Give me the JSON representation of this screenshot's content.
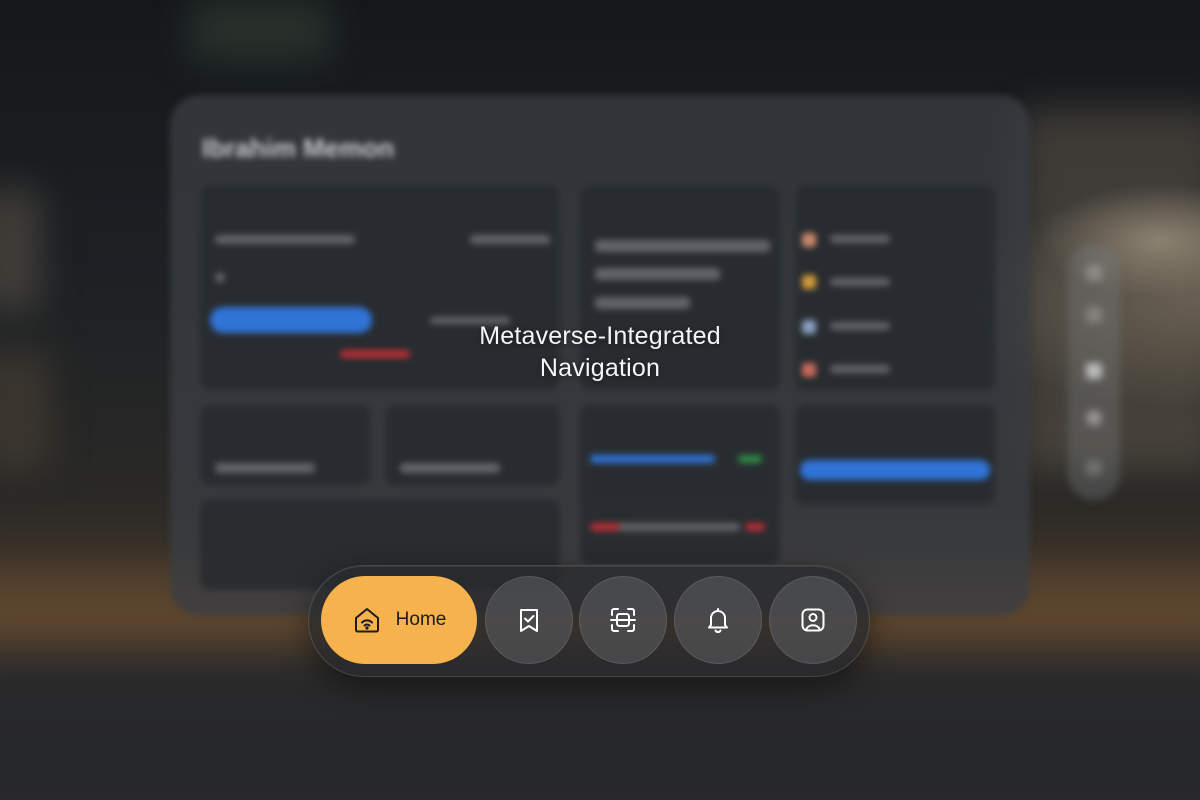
{
  "headline": {
    "line1": "Metaverse-Integrated",
    "line2": "Navigation"
  },
  "background_window": {
    "title": "Ibrahim Memon"
  },
  "dock": {
    "items": [
      {
        "label": "Home",
        "icon": "home-wifi-icon",
        "active": true
      },
      {
        "label": "",
        "icon": "bookmark-check-icon",
        "active": false
      },
      {
        "label": "",
        "icon": "scan-icon",
        "active": false
      },
      {
        "label": "",
        "icon": "bell-icon",
        "active": false
      },
      {
        "label": "",
        "icon": "profile-icon",
        "active": false
      }
    ]
  },
  "colors": {
    "accent": "#f6b24c",
    "button_blue": "#2f73d6",
    "text_light": "#f4f5f6"
  }
}
